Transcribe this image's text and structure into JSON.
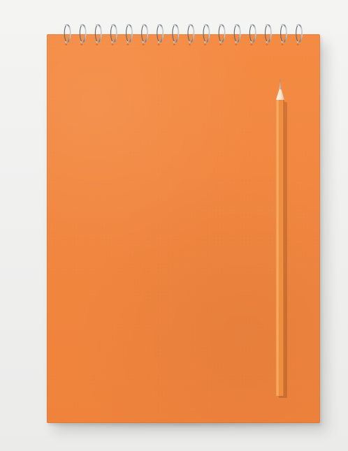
{
  "scene": {
    "background_color": "#f1f1f0",
    "notebook": {
      "color": "#f18740",
      "spiral_color": "#9ea4aa",
      "spiral_rings": 16
    },
    "pencil": {
      "color": "#f28b3b",
      "tip_color": "#f0e2cf",
      "lead_color": "#b8b8b8"
    }
  }
}
